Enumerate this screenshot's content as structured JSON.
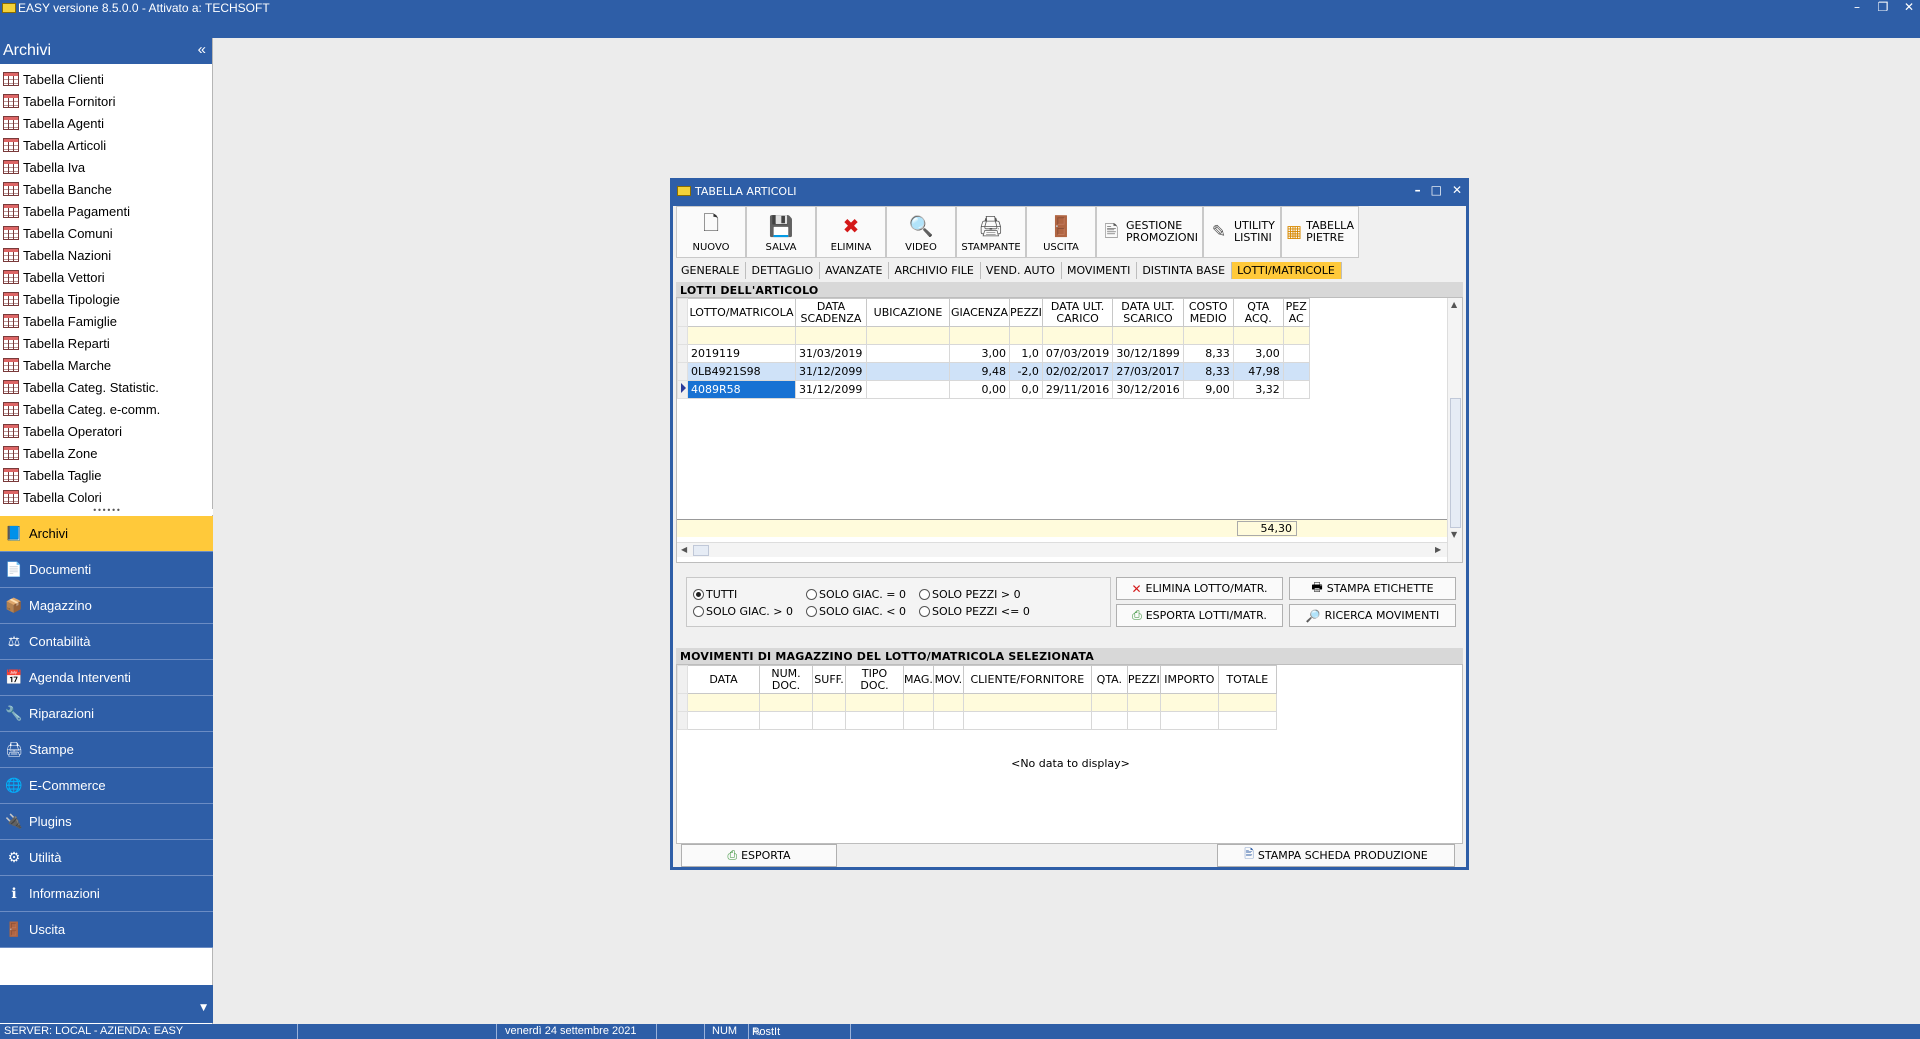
{
  "app": {
    "title": "EASY versione 8.5.0.0 - Attivato a: TECHSOFT",
    "window_controls": [
      "–",
      "❐",
      "✕"
    ]
  },
  "sidebar": {
    "header": "Archivi",
    "collapse_glyph": "«",
    "tree_items": [
      "Tabella Clienti",
      "Tabella Fornitori",
      "Tabella Agenti",
      "Tabella Articoli",
      "Tabella Iva",
      "Tabella Banche",
      "Tabella Pagamenti",
      "Tabella Comuni",
      "Tabella Nazioni",
      "Tabella Vettori",
      "Tabella Tipologie",
      "Tabella Famiglie",
      "Tabella Reparti",
      "Tabella Marche",
      "Tabella Categ. Statistic.",
      "Tabella Categ. e-comm.",
      "Tabella Operatori",
      "Tabella Zone",
      "Tabella Taglie",
      "Tabella Colori"
    ],
    "nav": [
      {
        "label": "Archivi",
        "icon": "archive-icon",
        "glyph": "📘",
        "active": true
      },
      {
        "label": "Documenti",
        "icon": "document-icon",
        "glyph": "📄"
      },
      {
        "label": "Magazzino",
        "icon": "warehouse-icon",
        "glyph": "📦"
      },
      {
        "label": "Contabilità",
        "icon": "scale-icon",
        "glyph": "⚖"
      },
      {
        "label": "Agenda Interventi",
        "icon": "agenda-icon",
        "glyph": "📅"
      },
      {
        "label": "Riparazioni",
        "icon": "repair-icon",
        "glyph": "🔧"
      },
      {
        "label": "Stampe",
        "icon": "printer-icon",
        "glyph": "🖨"
      },
      {
        "label": "E-Commerce",
        "icon": "globe-icon",
        "glyph": "🌐"
      },
      {
        "label": "Plugins",
        "icon": "plugin-icon",
        "glyph": "🔌"
      },
      {
        "label": "Utilità",
        "icon": "utility-icon",
        "glyph": "⚙"
      },
      {
        "label": "Informazioni",
        "icon": "info-icon",
        "glyph": "ℹ"
      },
      {
        "label": "Uscita",
        "icon": "exit-icon",
        "glyph": "🚪"
      }
    ]
  },
  "statusbar": {
    "server": "SERVER: LOCAL - AZIENDA: EASY",
    "date": "venerdì 24 settembre 2021",
    "num": "NUM",
    "postit": "PostIt"
  },
  "dialog": {
    "title": "TABELLA ARTICOLI",
    "controls": [
      "–",
      "□",
      "✕"
    ],
    "toolbar": [
      {
        "label": "NUOVO",
        "icon": "new-file-icon",
        "glyph": "🗋"
      },
      {
        "label": "SALVA",
        "icon": "save-icon",
        "glyph": "💾"
      },
      {
        "label": "ELIMINA",
        "icon": "delete-icon",
        "glyph": "✖"
      },
      {
        "label": "VIDEO",
        "icon": "preview-icon",
        "glyph": "🔍"
      },
      {
        "label": "STAMPANTE",
        "icon": "printer-icon",
        "glyph": "🖨"
      },
      {
        "label": "USCITA",
        "icon": "exit-door-icon",
        "glyph": "🚪"
      }
    ],
    "toolbar_wide": [
      {
        "line1": "GESTIONE",
        "line2": "PROMOZIONI",
        "icon": "promotions-icon",
        "glyph": "🖹"
      },
      {
        "line1": "UTILITY",
        "line2": "LISTINI",
        "icon": "pricelist-icon",
        "glyph": "✎"
      },
      {
        "line1": "TABELLA",
        "line2": "PIETRE",
        "icon": "stones-table-icon",
        "glyph": "▦"
      }
    ],
    "tabs": [
      "GENERALE",
      "DETTAGLIO",
      "AVANZATE",
      "ARCHIVIO FILE",
      "VEND. AUTO",
      "MOVIMENTI",
      "DISTINTA BASE",
      "LOTTI/MATRICOLE"
    ],
    "active_tab": "LOTTI/MATRICOLE",
    "lotti": {
      "header": "LOTTI DELL'ARTICOLO",
      "columns": [
        "LOTTO/MATRICOLA",
        "DATA SCADENZA",
        "UBICAZIONE",
        "GIACENZA",
        "PEZZI",
        "DATA ULT. CARICO",
        "DATA ULT. SCARICO",
        "COSTO MEDIO",
        "QTA ACQ.",
        "PEZ AC"
      ],
      "rows": [
        [
          "2019119",
          "31/03/2019",
          "",
          "3,00",
          "1,0",
          "07/03/2019",
          "30/12/1899",
          "8,33",
          "3,00",
          ""
        ],
        [
          "0LB4921S98",
          "31/12/2099",
          "",
          "9,48",
          "-2,0",
          "02/02/2017",
          "27/03/2017",
          "8,33",
          "47,98",
          ""
        ],
        [
          "4089R58",
          "31/12/2099",
          "",
          "0,00",
          "0,0",
          "29/11/2016",
          "30/12/2016",
          "9,00",
          "3,32",
          ""
        ]
      ],
      "total_qta_acq": "54,30"
    },
    "filters": [
      {
        "label": "TUTTI",
        "checked": true
      },
      {
        "label": "SOLO GIAC. > 0"
      },
      {
        "label": "SOLO GIAC. = 0"
      },
      {
        "label": "SOLO GIAC. < 0"
      },
      {
        "label": "SOLO PEZZI > 0"
      },
      {
        "label": "SOLO PEZZI <= 0"
      }
    ],
    "actions": {
      "elimina": "ELIMINA LOTTO/MATR.",
      "stampa_etichette": "STAMPA ETICHETTE",
      "esporta_lotti": "ESPORTA LOTTI/MATR.",
      "ricerca": "RICERCA MOVIMENTI"
    },
    "movimenti": {
      "header": "MOVIMENTI DI MAGAZZINO DEL LOTTO/MATRICOLA SELEZIONATA",
      "columns": [
        "DATA",
        "NUM. DOC.",
        "SUFF.",
        "TIPO DOC.",
        "MAG.",
        "MOV.",
        "CLIENTE/FORNITORE",
        "QTA.",
        "PEZZI",
        "IMPORTO",
        "TOTALE"
      ],
      "no_data": "<No data to display>"
    },
    "bottom": {
      "esporta": "ESPORTA",
      "stampa_scheda": "STAMPA SCHEDA PRODUZIONE"
    }
  }
}
